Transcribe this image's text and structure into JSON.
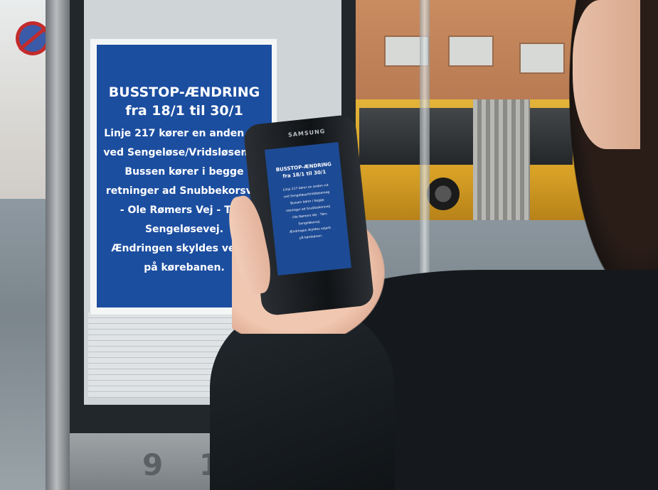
{
  "poster": {
    "title": "BUSSTOP-ÆNDRING",
    "dates": "fra 18/1 til 30/1",
    "lines": [
      "Linje 217 kører en anden rut",
      "ved Sengeløse/Vridsløsemag",
      "Bussen kører i begge",
      "retninger ad Snubbekorsvej",
      "- Ole Rømers Vej - Tørv",
      "Sengeløsevej.",
      "Ændringen skyldes vejarb",
      "på kørebanen."
    ]
  },
  "phone": {
    "brand": "SAMSUNG",
    "screen_title": "BUSSTOP-ÆNDRING",
    "screen_dates": "fra 18/1 til 30/1"
  },
  "shelter": {
    "numbers": "9 10"
  },
  "colors": {
    "poster_blue": "#1c4ea0",
    "bus_yellow": "#d8a126"
  }
}
